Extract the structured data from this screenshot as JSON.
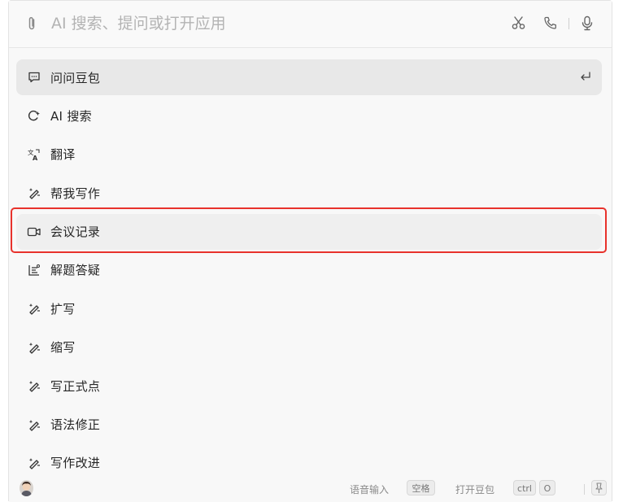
{
  "search": {
    "placeholder": "AI 搜索、提问或打开应用",
    "value": ""
  },
  "top_icons": [
    "scissors-icon",
    "phone-icon",
    "microphone-icon"
  ],
  "items": [
    {
      "label": "问问豆包",
      "icon": "chat-bubble-icon",
      "selected": true
    },
    {
      "label": "AI 搜索",
      "icon": "ai-search-icon"
    },
    {
      "label": "翻译",
      "icon": "translate-icon"
    },
    {
      "label": "帮我写作",
      "icon": "pen-sparkle-icon"
    },
    {
      "label": "会议记录",
      "icon": "video-camera-icon",
      "highlighted": true
    },
    {
      "label": "解题答疑",
      "icon": "problem-solve-icon"
    },
    {
      "label": "扩写",
      "icon": "pen-sparkle-icon"
    },
    {
      "label": "缩写",
      "icon": "pen-sparkle-icon"
    },
    {
      "label": "写正式点",
      "icon": "pen-sparkle-icon"
    },
    {
      "label": "语法修正",
      "icon": "pen-sparkle-icon"
    },
    {
      "label": "写作改进",
      "icon": "pen-sparkle-icon"
    }
  ],
  "footer": {
    "voice_input_label": "语音输入",
    "voice_input_key": "空格",
    "open_doubao_label": "打开豆包",
    "open_doubao_key1": "ctrl",
    "open_doubao_key2": "O"
  },
  "colors": {
    "highlight_border": "#e8322c",
    "selected_bg": "#e8e8e8",
    "panel_bg": "#f8f8f8"
  }
}
